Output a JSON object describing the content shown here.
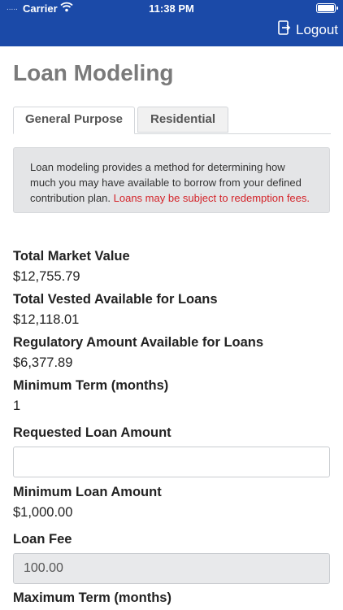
{
  "status_bar": {
    "carrier": "Carrier",
    "time": "11:38 PM",
    "signal": "....."
  },
  "header": {
    "logout_label": "Logout"
  },
  "page": {
    "title": "Loan Modeling"
  },
  "tabs": [
    {
      "label": "General Purpose",
      "active": true
    },
    {
      "label": "Residential",
      "active": false
    }
  ],
  "info": {
    "text": "Loan modeling provides a method for determining how much you may have available to borrow from your defined contribution plan.",
    "warning": "Loans may be subject to redemption fees."
  },
  "fields": {
    "total_market_value": {
      "label": "Total Market Value",
      "value": "$12,755.79"
    },
    "total_vested": {
      "label": "Total Vested Available for Loans",
      "value": "$12,118.01"
    },
    "regulatory_amount": {
      "label": "Regulatory Amount Available for Loans",
      "value": "$6,377.89"
    },
    "minimum_term": {
      "label": "Minimum Term (months)",
      "value": "1"
    },
    "requested_amount": {
      "label": "Requested Loan Amount",
      "value": "",
      "placeholder": ""
    },
    "minimum_loan": {
      "label": "Minimum Loan Amount",
      "value": "$1,000.00"
    },
    "loan_fee": {
      "label": "Loan Fee",
      "value": "100.00"
    },
    "maximum_term": {
      "label": "Maximum Term (months)"
    }
  },
  "colors": {
    "header": "#1b4aa8",
    "warning": "#d4242a",
    "title": "#7a7a7a"
  }
}
